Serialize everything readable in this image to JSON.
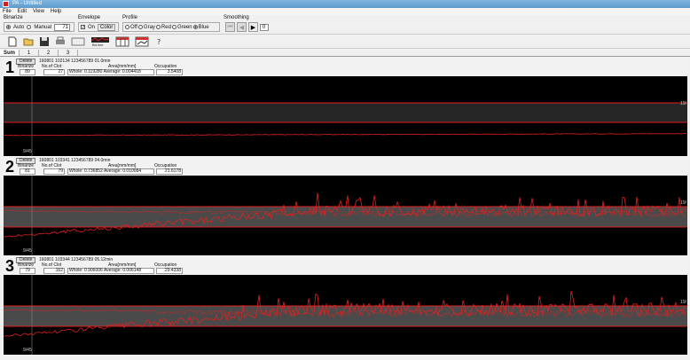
{
  "window": {
    "title": "PA - Untitled"
  },
  "menu": [
    "File",
    "Edit",
    "View",
    "Help"
  ],
  "options": {
    "binarize": {
      "label": "Binarize",
      "auto": "Auto",
      "manual": "Manual",
      "value": "71"
    },
    "envelope": {
      "label": "Envelope",
      "on": "On",
      "color_btn": "Color"
    },
    "profile": {
      "label": "Profile",
      "options": [
        "Off",
        "Gray",
        "Red",
        "Green",
        "Blue"
      ],
      "selected": "Blue"
    },
    "smoothing": {
      "label": "Smoothing",
      "value": "0"
    }
  },
  "toolbar": {
    "mid_label": "Brt.line"
  },
  "tabs": [
    "Sum",
    "1",
    "2",
    "3"
  ],
  "headers": {
    "delete": "Delete",
    "binarize": "Binarize",
    "clot": "No.of Clot",
    "area": "Area[mm/mm]",
    "occupation": "Occupation",
    "whole_prefix": "Whole:",
    "average_prefix": "Average:"
  },
  "panels": [
    {
      "num": "1",
      "file": "160801 102134 123456789 01.0min",
      "binarize": "89",
      "clot": "27",
      "whole": "0.119280",
      "average": "0.004418",
      "occupation": "3.5408",
      "top_label": "19/",
      "bottom_label": "9/45"
    },
    {
      "num": "2",
      "file": "160801 103341 123456789 04.0min",
      "binarize": "81",
      "clot": "79",
      "whole": "0.736852",
      "average": "0.010084",
      "occupation": "21.6178",
      "top_label": "19/",
      "bottom_label": "9/45"
    },
    {
      "num": "3",
      "file": "160801 103344 123456789 05.12min",
      "binarize": "79",
      "clot": "162",
      "whole": "0.906006",
      "average": "0.006148",
      "occupation": "29.4338",
      "top_label": "19/",
      "bottom_label": "9/45"
    }
  ],
  "colors": {
    "trace": "#e02020",
    "background": "#000000",
    "band": "#4a4a4a"
  }
}
